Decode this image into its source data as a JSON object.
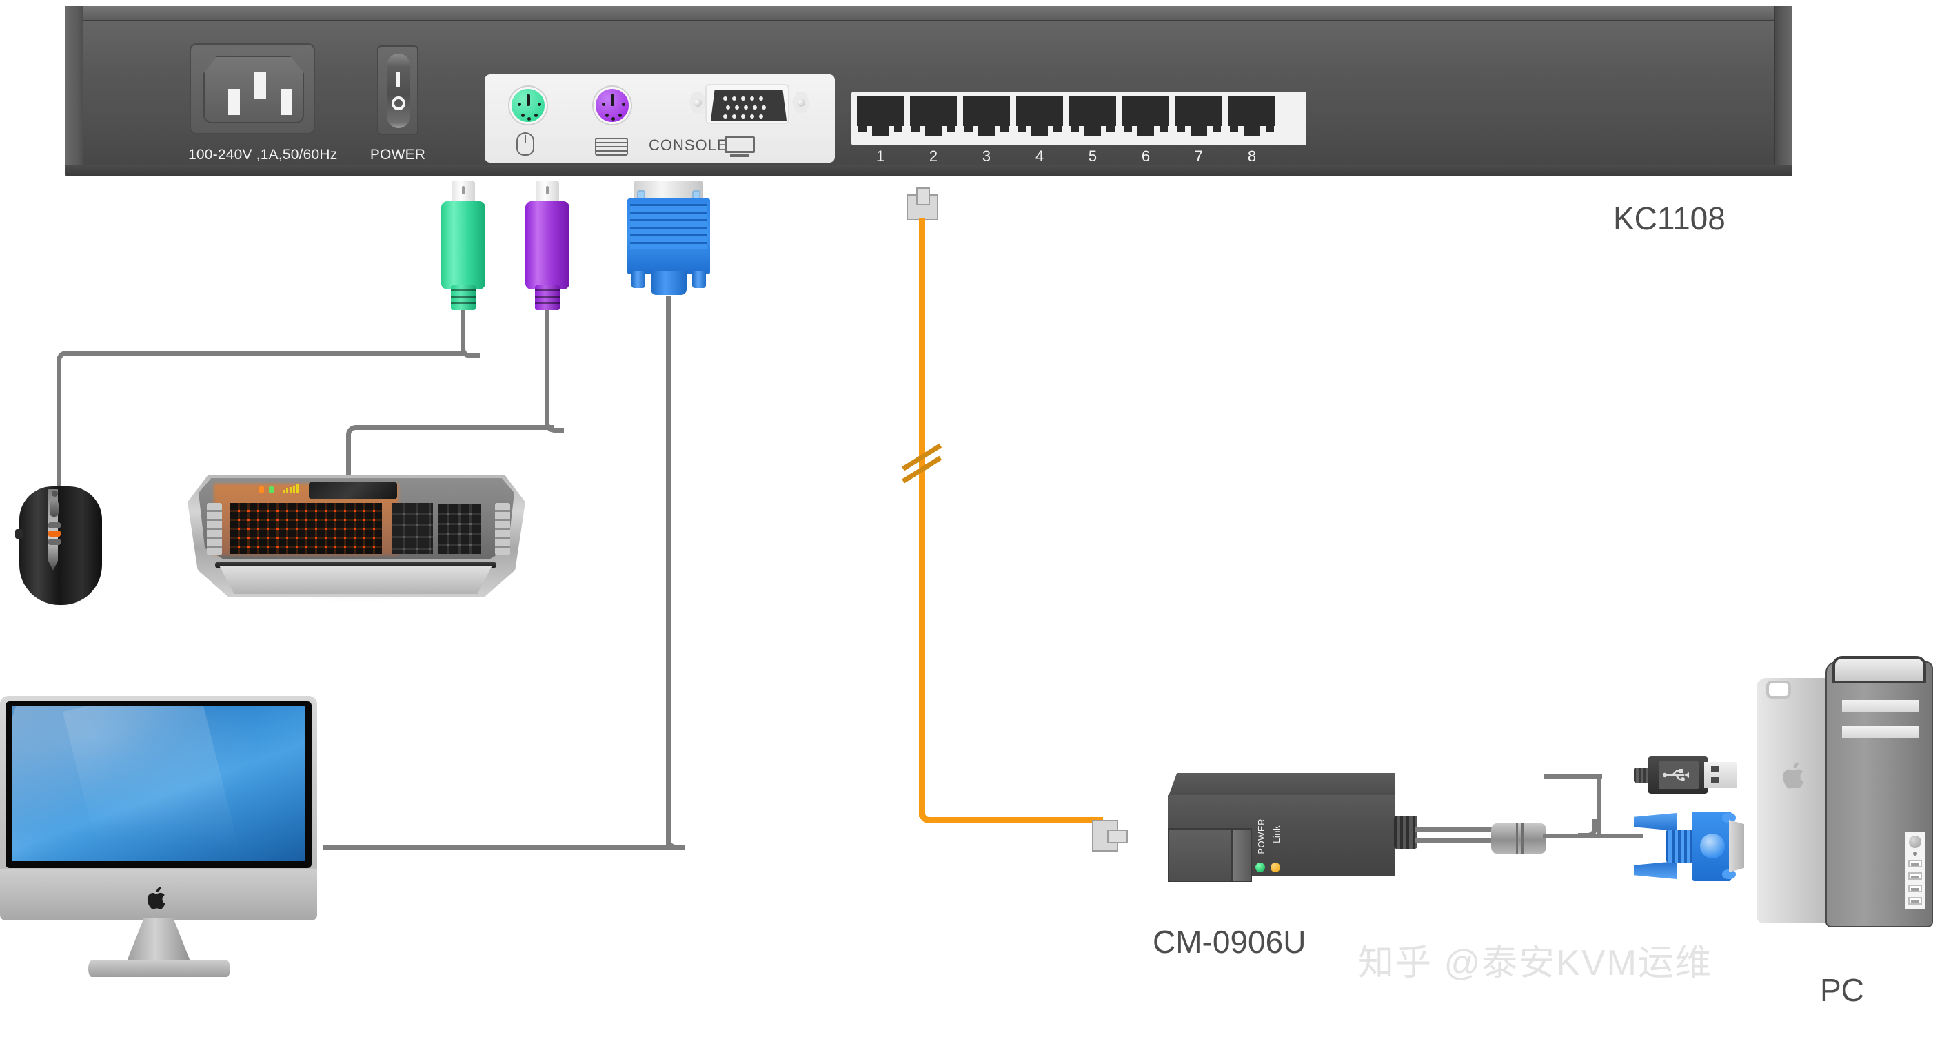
{
  "diagram": {
    "title_labels": {
      "kvm_model": "KC1108",
      "adapter_model": "CM-0906U",
      "computer": "PC"
    },
    "watermark": "知乎 @泰安KVM运维"
  },
  "kvm_switch": {
    "model": "KC1108",
    "power_inlet": {
      "rating_label": "100-240V ,1A,50/60Hz"
    },
    "power_switch": {
      "label": "POWER",
      "on_mark": "I",
      "off_mark": "O"
    },
    "console": {
      "label": "CONSOLE",
      "ports": [
        {
          "name": "ps2-mouse",
          "color": "#21d68f",
          "icon": "mouse-icon"
        },
        {
          "name": "ps2-keyboard",
          "color": "#9b1fe0",
          "icon": "keyboard-icon"
        },
        {
          "name": "vga-monitor",
          "color": "#3a3a3a",
          "icon": "monitor-icon"
        }
      ]
    },
    "rj45_ports": {
      "count": 8,
      "numbers": [
        "1",
        "2",
        "3",
        "4",
        "5",
        "6",
        "7",
        "8"
      ]
    }
  },
  "console_devices": {
    "mouse": {
      "name": "gaming-mouse",
      "connector_color": "#21d68f"
    },
    "keyboard": {
      "name": "gaming-keyboard",
      "connector_color": "#9b1fe0"
    },
    "monitor": {
      "name": "lcd-monitor",
      "connector_color": "#2f86e8"
    }
  },
  "adapter": {
    "model": "CM-0906U",
    "leds": [
      {
        "label": "POWER",
        "color": "#0dab52"
      },
      {
        "label": "Link",
        "color": "#eea40d"
      }
    ],
    "cable_color": "#f79a12",
    "cable_type": "cat5-rj45"
  },
  "pc_connectors": {
    "usb": {
      "name": "usb-a-connector",
      "color": "#2d2d2d"
    },
    "vga": {
      "name": "vga-connector",
      "color": "#3d93f0"
    }
  }
}
